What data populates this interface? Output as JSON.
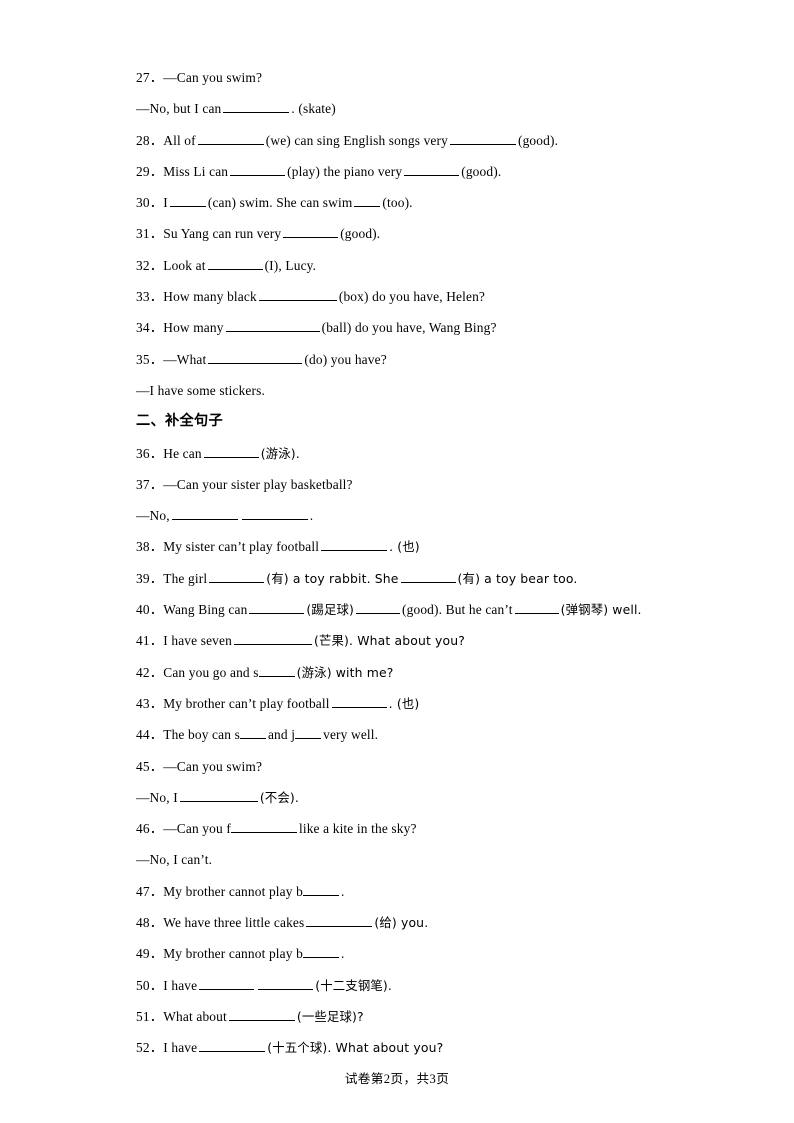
{
  "document": {
    "page_footer": {
      "prefix": "试卷第",
      "current_page": "2",
      "middle": "页，共",
      "total_pages": "3",
      "suffix": "页"
    }
  },
  "lines": [
    {
      "id": "q27",
      "kind": "question",
      "number": "27",
      "text": "—Can you swim?"
    },
    {
      "id": "q27b",
      "kind": "continuation",
      "text": "—No, but I can"
    },
    {
      "id": "q27b_tail",
      "kind": "tail",
      "text": ". (skate)"
    },
    {
      "id": "q28",
      "kind": "question",
      "number": "28",
      "seg1": "All of",
      "seg2": "(we) can sing English songs very",
      "seg3": "(good)."
    },
    {
      "id": "q29",
      "kind": "question",
      "number": "29",
      "seg1": "Miss Li can",
      "seg2": "(play) the piano very",
      "seg3": "(good)."
    },
    {
      "id": "q30",
      "kind": "question",
      "number": "30",
      "seg1": "I",
      "seg2": "(can) swim. She can swim",
      "seg3": "(too)."
    },
    {
      "id": "q31",
      "kind": "question",
      "number": "31",
      "seg1": "Su Yang can run very",
      "seg2": "(good)."
    },
    {
      "id": "q32",
      "kind": "question",
      "number": "32",
      "seg1": "Look at",
      "seg2": "(I), Lucy."
    },
    {
      "id": "q33",
      "kind": "question",
      "number": "33",
      "seg1": "How many black",
      "seg2": "(box) do you have, Helen?"
    },
    {
      "id": "q34",
      "kind": "question",
      "number": "34",
      "seg1": "How many",
      "seg2": "(ball) do you have, Wang Bing?"
    },
    {
      "id": "q35",
      "kind": "question",
      "number": "35",
      "seg1": "—What",
      "seg2": "(do) you have?"
    },
    {
      "id": "q35b",
      "kind": "continuation",
      "text": "—I have some stickers."
    },
    {
      "id": "section2",
      "kind": "section",
      "text": "二、补全句子"
    },
    {
      "id": "q36",
      "kind": "question",
      "number": "36",
      "seg1": "He can",
      "seg2": "(游泳)."
    },
    {
      "id": "q37",
      "kind": "question",
      "number": "37",
      "text": "—Can your sister play basketball?"
    },
    {
      "id": "q37b",
      "kind": "continuation",
      "text": "—No,"
    },
    {
      "id": "q37b_tail",
      "kind": "tail",
      "text": "."
    },
    {
      "id": "q38",
      "kind": "question",
      "number": "38",
      "seg1": "My sister can’t play football",
      "seg2": ". (也)"
    },
    {
      "id": "q39",
      "kind": "question",
      "number": "39",
      "seg1": "The girl",
      "seg2": "(有) a toy rabbit. She",
      "seg3": "(有) a toy bear too."
    },
    {
      "id": "q40",
      "kind": "question",
      "number": "40",
      "seg1": "Wang Bing can",
      "seg2": "(踢足球)",
      "seg3": "(good). But he can’t",
      "seg4": "(弹钢琴) well."
    },
    {
      "id": "q41",
      "kind": "question",
      "number": "41",
      "seg1": "I have seven",
      "seg2": "(芒果). What about you?"
    },
    {
      "id": "q42",
      "kind": "question",
      "number": "42",
      "seg1": "Can you go and s",
      "seg2": "(游泳) with me?"
    },
    {
      "id": "q43",
      "kind": "question",
      "number": "43",
      "seg1": "My brother can’t play football",
      "seg2": ". (也)"
    },
    {
      "id": "q44",
      "kind": "question",
      "number": "44",
      "seg1": "The boy can s",
      "seg2": "and j",
      "seg3": "very well."
    },
    {
      "id": "q45",
      "kind": "question",
      "number": "45",
      "text": "—Can you swim?"
    },
    {
      "id": "q45b",
      "kind": "continuation",
      "text": "—No, I"
    },
    {
      "id": "q45b_tail",
      "kind": "tail",
      "text": "(不会)."
    },
    {
      "id": "q46",
      "kind": "question",
      "number": "46",
      "seg1": "—Can you f",
      "seg2": "like a kite in the sky?"
    },
    {
      "id": "q46b",
      "kind": "continuation",
      "text": "—No, I can’t."
    },
    {
      "id": "q47",
      "kind": "question",
      "number": "47",
      "seg1": "My brother cannot play b",
      "seg2": "."
    },
    {
      "id": "q48",
      "kind": "question",
      "number": "48",
      "seg1": "We have three little cakes",
      "seg2": "(给) you."
    },
    {
      "id": "q49",
      "kind": "question",
      "number": "49",
      "seg1": "My brother cannot play b",
      "seg2": "."
    },
    {
      "id": "q50",
      "kind": "question",
      "number": "50",
      "seg1": "I have",
      "seg2": "(十二支钢笔)."
    },
    {
      "id": "q51",
      "kind": "question",
      "number": "51",
      "seg1": "What about",
      "seg2": "(一些足球)?"
    },
    {
      "id": "q52",
      "kind": "question",
      "number": "52",
      "seg1": "I have",
      "seg2": "(十五个球). What about you?"
    }
  ]
}
